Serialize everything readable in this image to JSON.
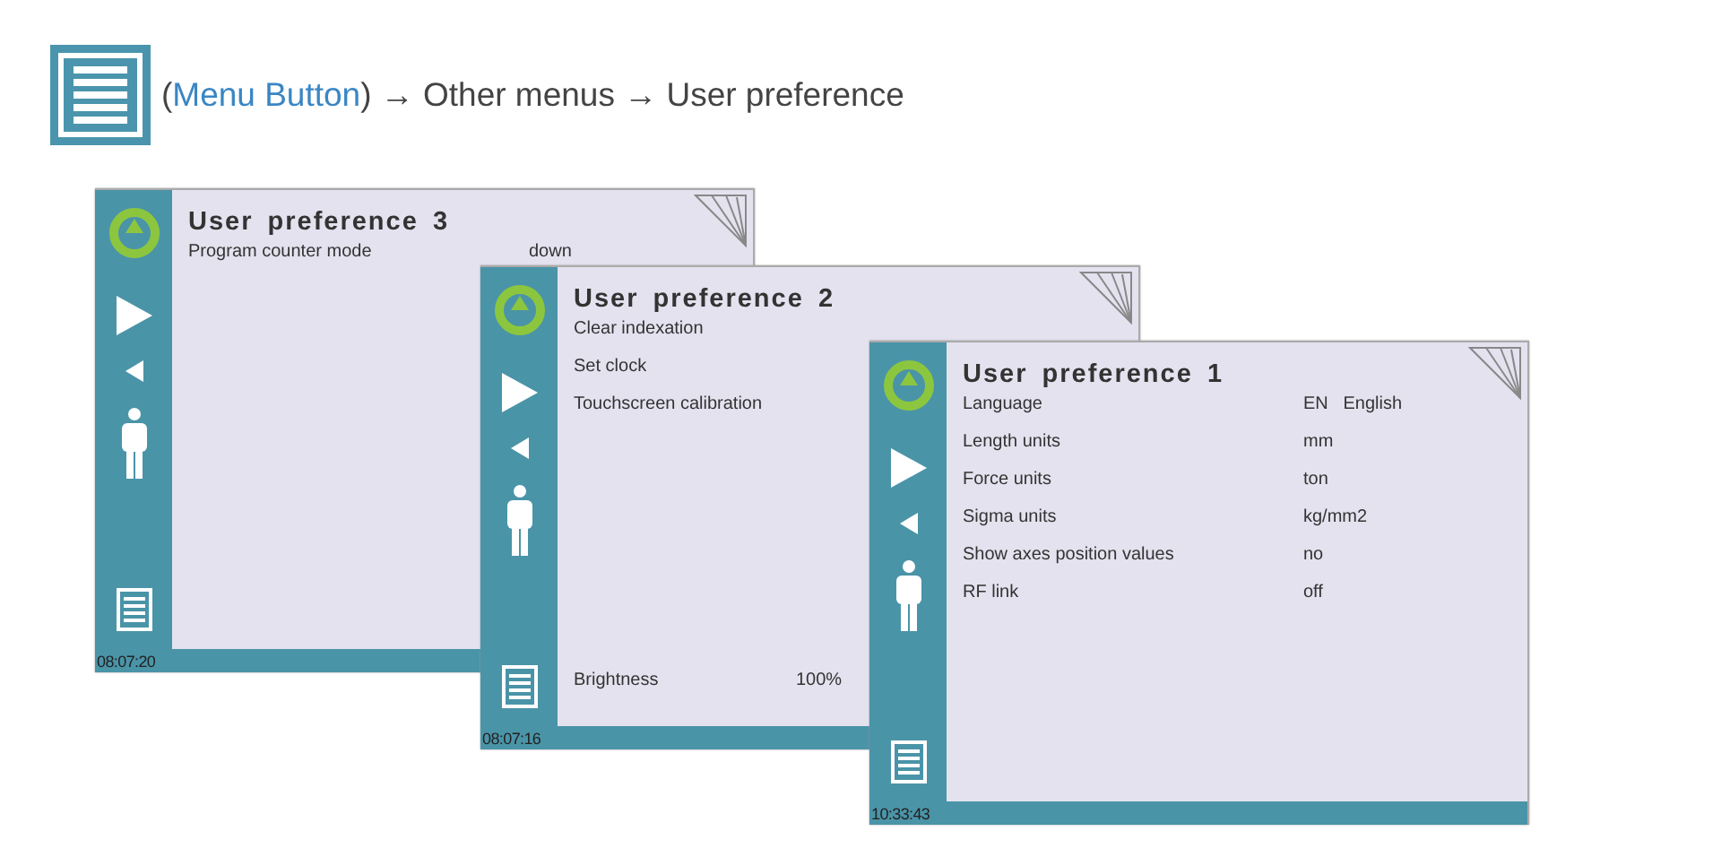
{
  "breadcrumb": {
    "open": "(",
    "link": "Menu Button",
    "rest": ") → Other menus → User preference"
  },
  "screens": [
    {
      "title": "User preference 3",
      "time": "08:07:20",
      "rows": [
        {
          "kind": "setting",
          "label": "Program counter mode",
          "value": "down"
        }
      ]
    },
    {
      "title": "User preference 2",
      "time": "08:07:16",
      "rows": [
        {
          "kind": "setting",
          "label": "Clear indexation"
        },
        {
          "kind": "setting",
          "label": "Set clock"
        },
        {
          "kind": "setting",
          "label": "Touchscreen calibration"
        },
        {
          "kind": "footer",
          "label": "Brightness",
          "value": "100%"
        }
      ]
    },
    {
      "title": "User preference 1",
      "time": "10:33:43",
      "rows": [
        {
          "kind": "setting",
          "label": "Language",
          "value": "EN   English"
        },
        {
          "kind": "setting",
          "label": "Length units",
          "value": "mm"
        },
        {
          "kind": "setting",
          "label": "Force units",
          "value": "ton"
        },
        {
          "kind": "setting",
          "label": "Sigma units",
          "value": "kg/mm2"
        },
        {
          "kind": "setting",
          "label": "Show axes position values",
          "value": "no"
        },
        {
          "kind": "setting",
          "label": "RF link",
          "value": "off"
        }
      ]
    }
  ]
}
